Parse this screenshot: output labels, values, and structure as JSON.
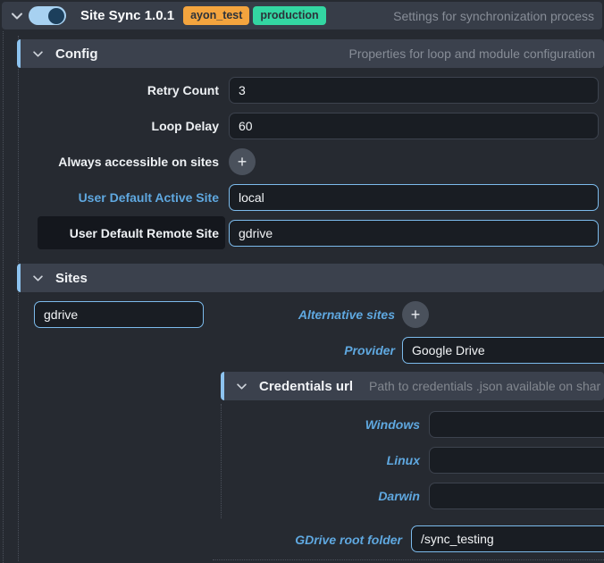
{
  "topbar": {
    "title": "Site Sync 1.0.1",
    "toggle_state": "on",
    "badges": [
      {
        "label": "ayon_test",
        "color": "#f3a43e"
      },
      {
        "label": "production",
        "color": "#33d6a2"
      }
    ],
    "description": "Settings for synchronization process"
  },
  "config": {
    "title": "Config",
    "description": "Properties for loop and module configuration",
    "retry_count": {
      "label": "Retry Count",
      "value": "3"
    },
    "loop_delay": {
      "label": "Loop Delay",
      "value": "60"
    },
    "always_accessible": {
      "label": "Always accessible on sites"
    },
    "active_site": {
      "label": "User Default Active Site",
      "value": "local"
    },
    "remote_site": {
      "label": "User Default Remote Site",
      "value": "gdrive"
    }
  },
  "sites": {
    "title": "Sites",
    "site_name": {
      "value": "gdrive"
    },
    "alternative_sites": {
      "label": "Alternative sites"
    },
    "provider": {
      "label": "Provider",
      "value": "Google Drive"
    },
    "credentials": {
      "title": "Credentials url",
      "description": "Path to credentials .json available on shar",
      "windows": {
        "label": "Windows",
        "value": ""
      },
      "linux": {
        "label": "Linux",
        "value": ""
      },
      "darwin": {
        "label": "Darwin",
        "value": ""
      }
    },
    "root_folder": {
      "label": "GDrive root folder",
      "value": "/sync_testing"
    }
  },
  "icons": {
    "plus": "+"
  },
  "colors": {
    "accent_bar": "#8dc3ef",
    "changed_border": "#7cbbec",
    "header_bg": "#3b414d",
    "page_bg": "#262a31",
    "input_bg": "#191d23"
  }
}
